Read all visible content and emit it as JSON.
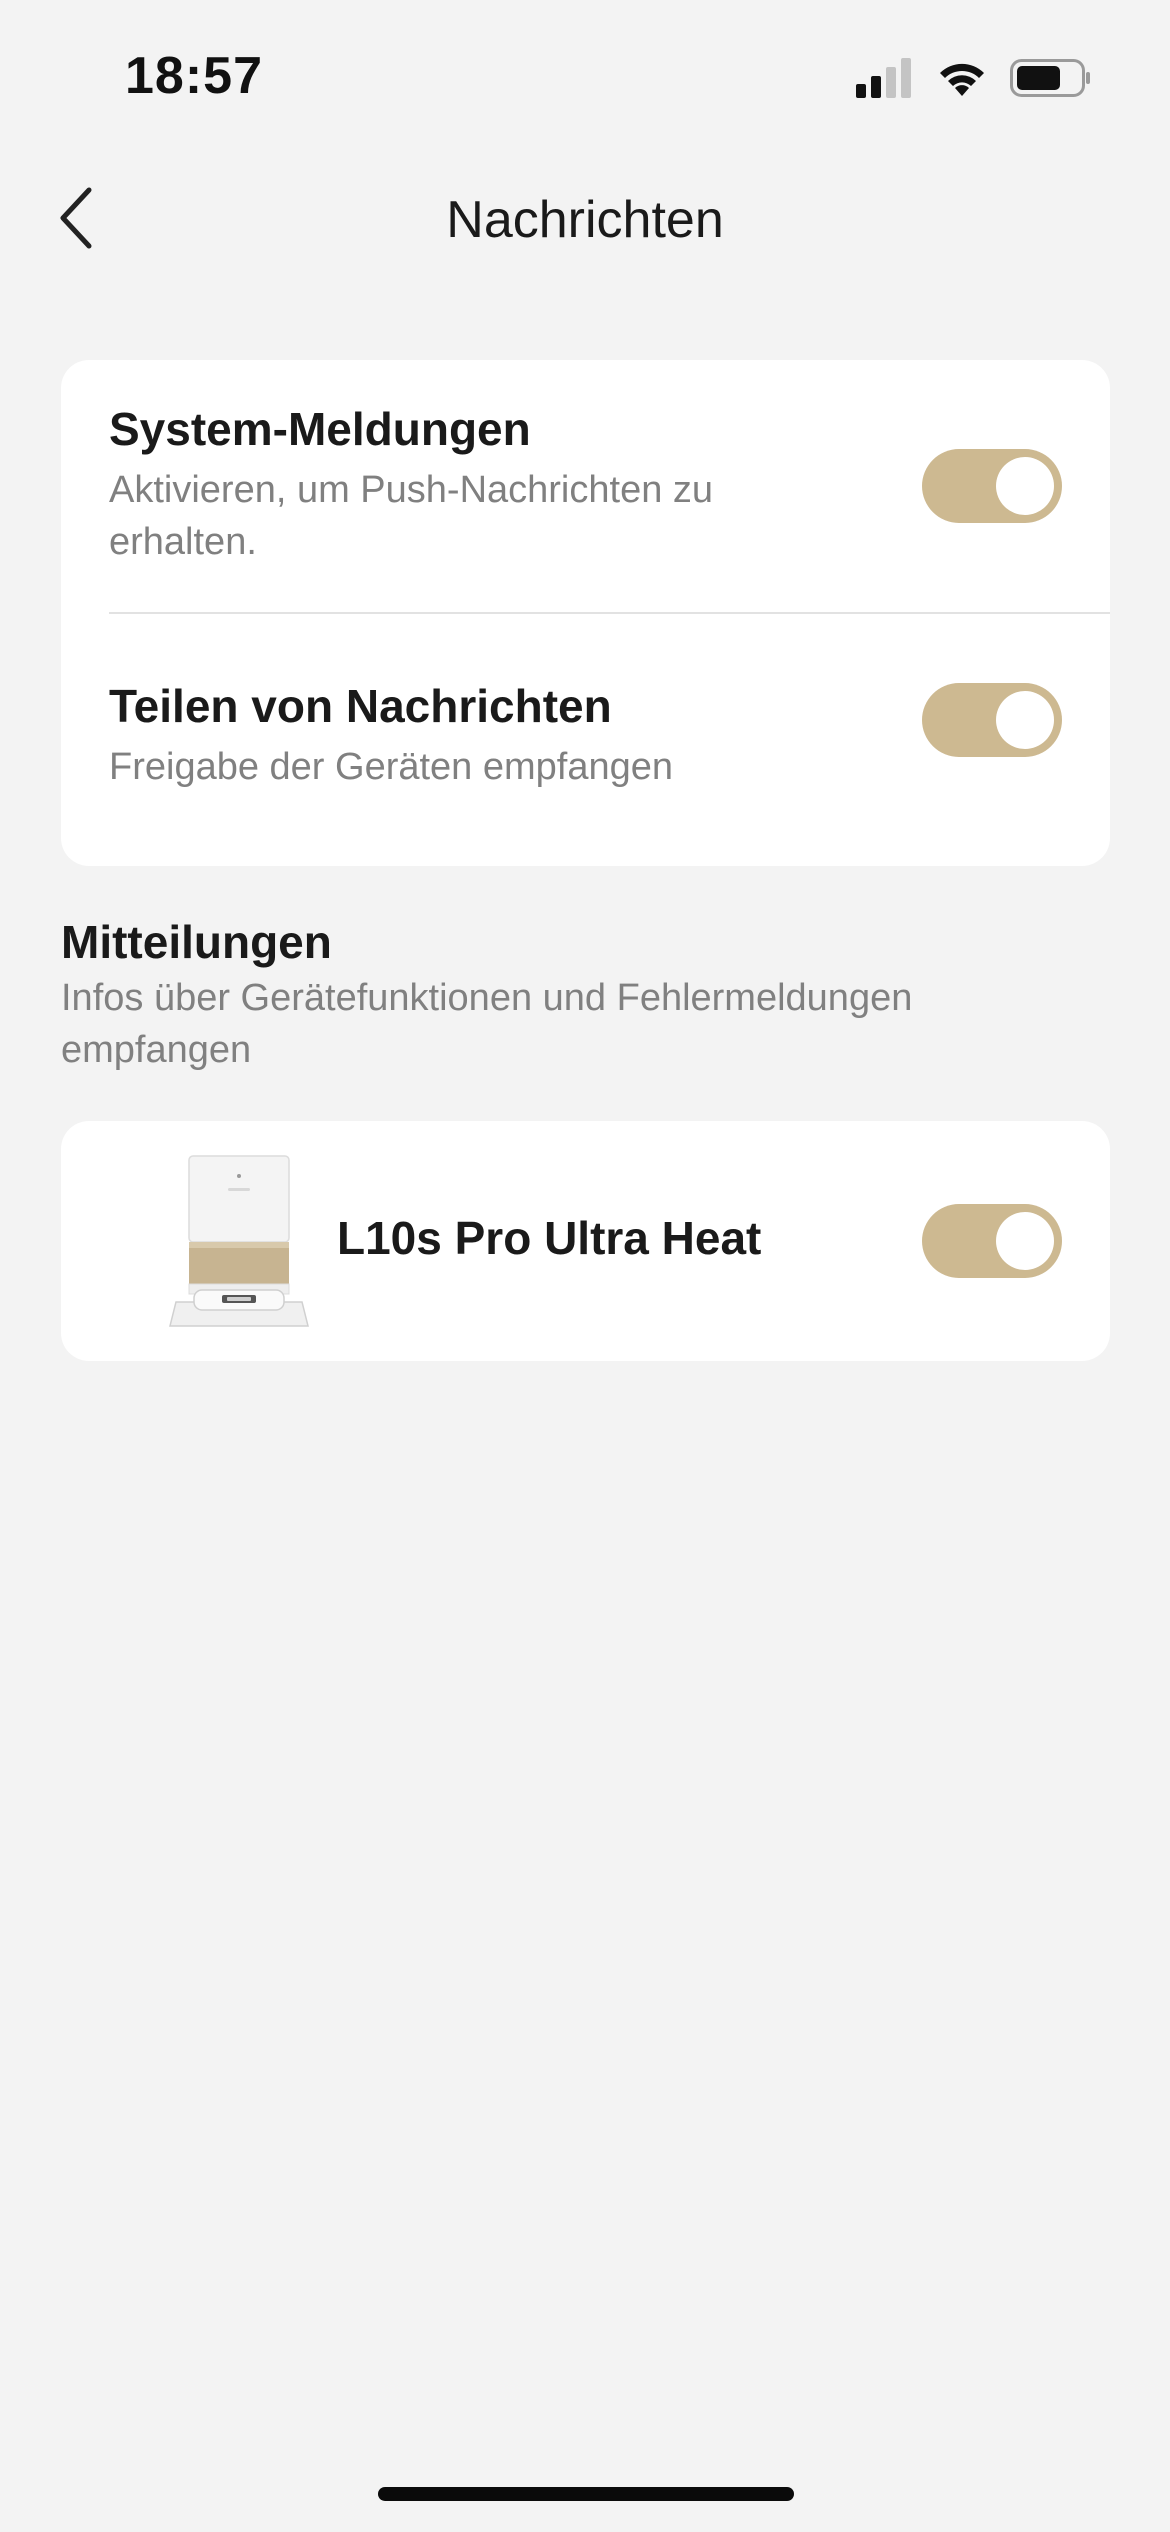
{
  "status_bar": {
    "time": "18:57",
    "battery_level": 0.7
  },
  "nav": {
    "title": "Nachrichten"
  },
  "settings": [
    {
      "title": "System-Meldungen",
      "description": "Aktivieren, um Push-Nachrichten zu erhalten.",
      "enabled": true
    },
    {
      "title": "Teilen von Nachrichten",
      "description": "Freigabe der Geräten empfangen",
      "enabled": true
    }
  ],
  "notifications_section": {
    "title": "Mitteilungen",
    "description": "Infos über Gerätefunktionen und Fehlermeldungen empfangen"
  },
  "devices": [
    {
      "name": "L10s Pro Ultra Heat",
      "enabled": true
    }
  ],
  "colors": {
    "background": "#f3f3f3",
    "card": "#ffffff",
    "toggle_on": "#cdb991",
    "secondary_text": "#808080"
  }
}
